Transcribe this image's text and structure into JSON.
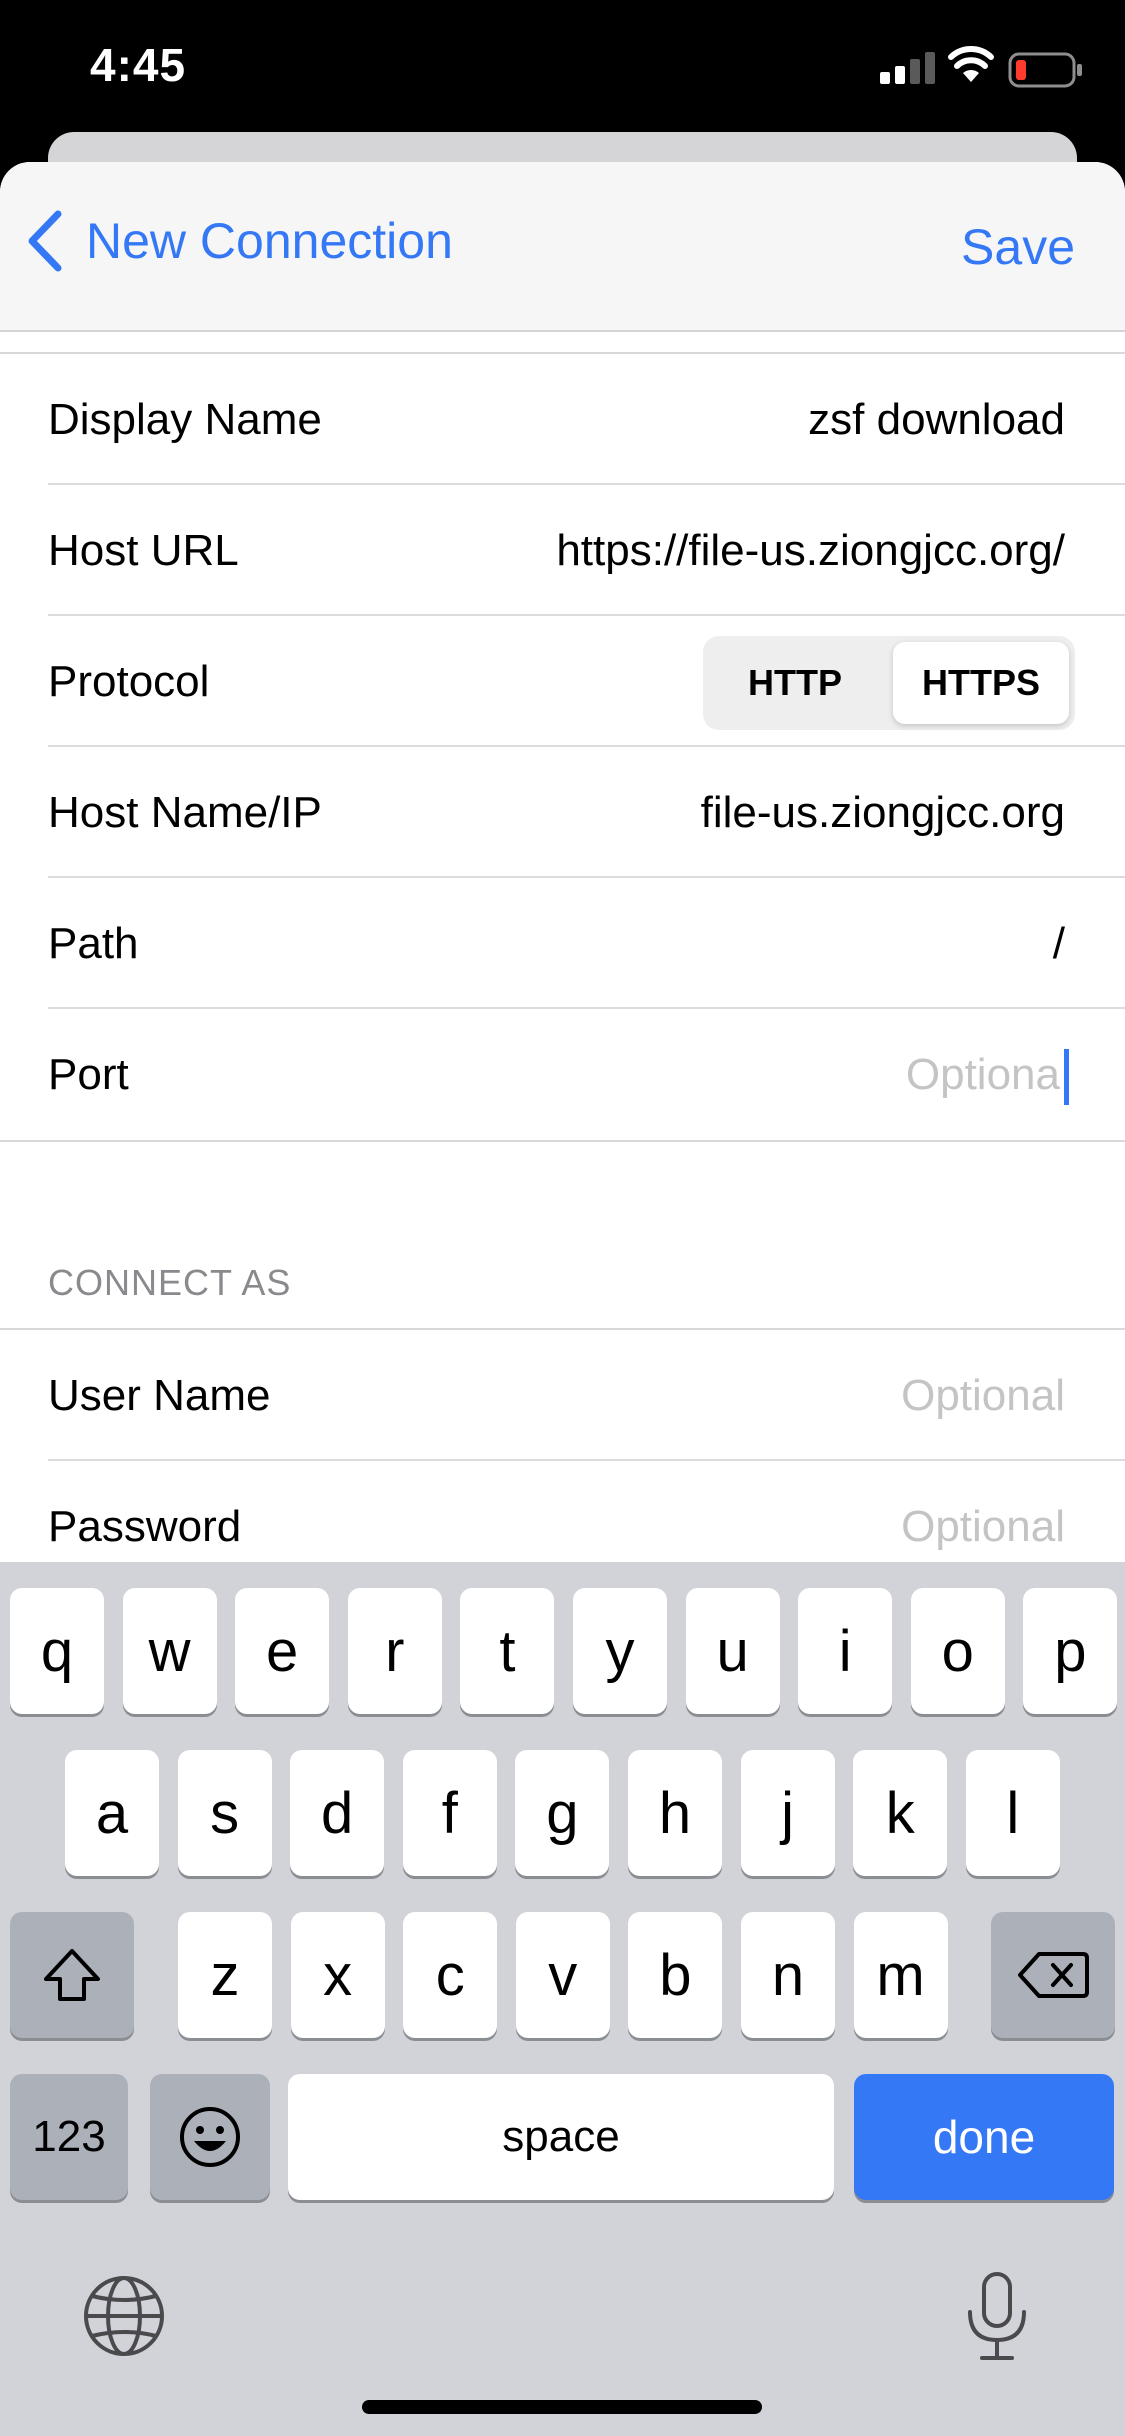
{
  "status_bar": {
    "time": "4:45"
  },
  "nav": {
    "back_label": "New Connection",
    "save_label": "Save"
  },
  "connection": {
    "display_name": {
      "label": "Display Name",
      "value": "zsf download"
    },
    "host_url": {
      "label": "Host URL",
      "value": "https://file-us.ziongjcc.org/"
    },
    "protocol": {
      "label": "Protocol",
      "options": [
        "HTTP",
        "HTTPS"
      ],
      "selected": "HTTPS"
    },
    "host_name": {
      "label": "Host Name/IP",
      "value": "file-us.ziongjcc.org"
    },
    "path": {
      "label": "Path",
      "value": "/"
    },
    "port": {
      "label": "Port",
      "placeholder": "Optiona"
    }
  },
  "connect_as": {
    "header": "CONNECT AS",
    "user_name": {
      "label": "User Name",
      "placeholder": "Optional"
    },
    "password": {
      "label": "Password",
      "placeholder": "Optional"
    }
  },
  "keyboard": {
    "row1": [
      "q",
      "w",
      "e",
      "r",
      "t",
      "y",
      "u",
      "i",
      "o",
      "p"
    ],
    "row2": [
      "a",
      "s",
      "d",
      "f",
      "g",
      "h",
      "j",
      "k",
      "l"
    ],
    "row3": [
      "z",
      "x",
      "c",
      "v",
      "b",
      "n",
      "m"
    ],
    "numbers_label": "123",
    "space_label": "space",
    "done_label": "done"
  }
}
